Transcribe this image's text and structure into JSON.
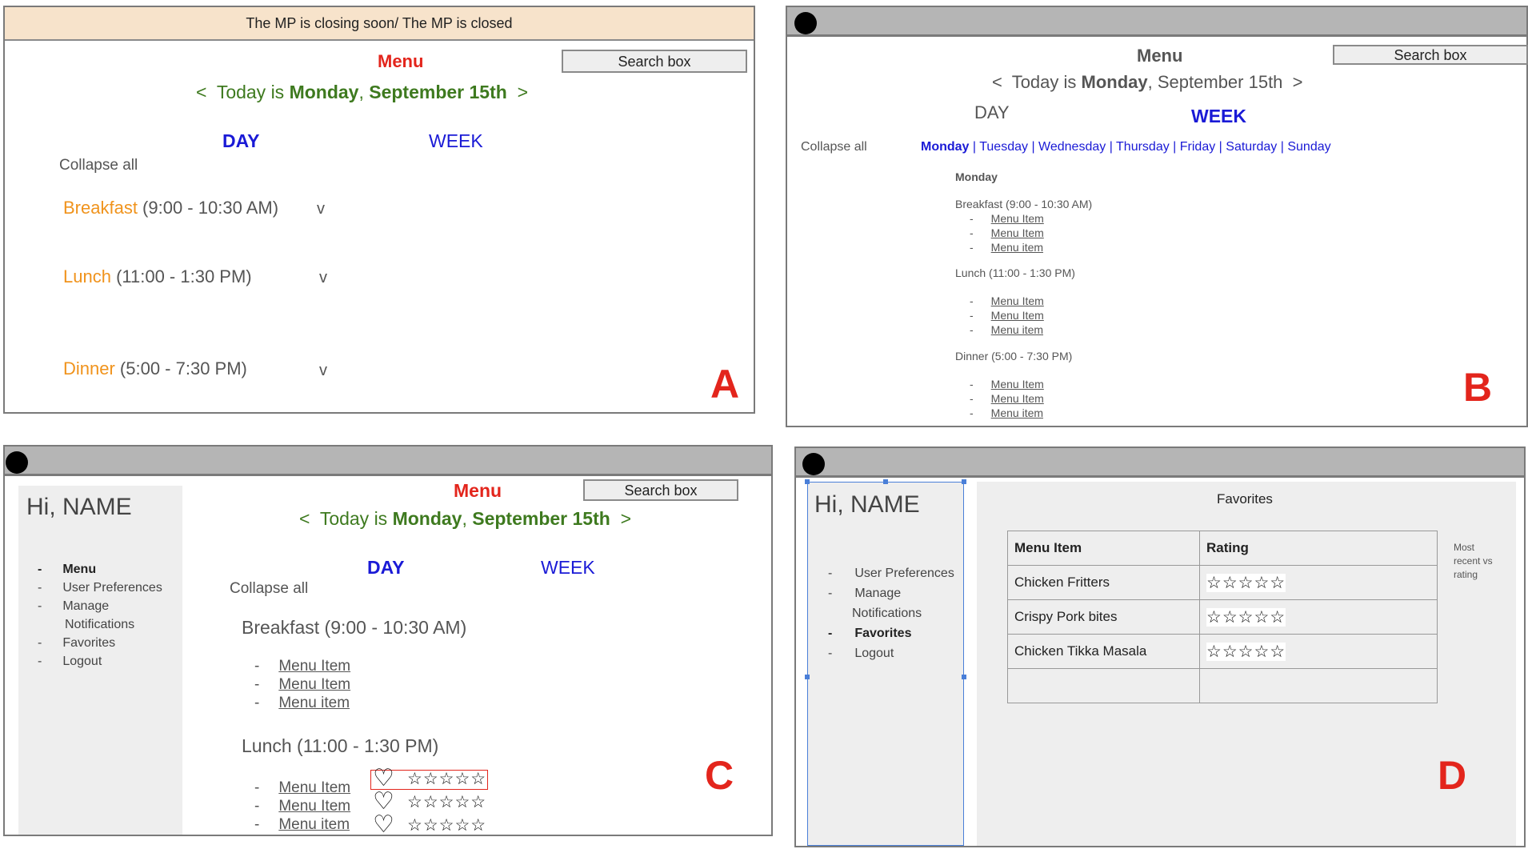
{
  "panel_a": {
    "banner": "The MP is closing soon/ The MP is closed",
    "menu_title": "Menu",
    "search": "Search box",
    "date_prev": "<",
    "date_prefix": "Today is ",
    "date_day": "Monday",
    "date_sep": ", ",
    "date_date": "September 15th",
    "date_next": ">",
    "tab_day": "DAY",
    "tab_week": "WEEK",
    "collapse": "Collapse all",
    "meals": [
      {
        "name": "Breakfast",
        "time": " (9:00 - 10:30 AM)",
        "toggle": "v"
      },
      {
        "name": "Lunch",
        "time": " (11:00 - 1:30 PM)",
        "toggle": "v"
      },
      {
        "name": "Dinner",
        "time": " (5:00 - 7:30 PM)",
        "toggle": "v"
      }
    ],
    "letter": "A"
  },
  "panel_b": {
    "menu_title": "Menu",
    "search": "Search box",
    "date_prev": "<",
    "date_prefix": "Today is ",
    "date_day": "Monday",
    "date_sep": ", ",
    "date_date": "September 15th",
    "date_next": ">",
    "tab_day": "DAY",
    "tab_week": "WEEK",
    "collapse": "Collapse all",
    "days": [
      "Monday",
      "Tuesday",
      "Wednesday",
      "Thursday",
      "Friday",
      "Saturday",
      "Sunday"
    ],
    "day_sep": " | ",
    "day_heading": "Monday",
    "meals": [
      {
        "header": "Breakfast  (9:00 - 10:30 AM)",
        "items": [
          "Menu Item",
          "Menu Item",
          "Menu item"
        ]
      },
      {
        "header": "Lunch (11:00 - 1:30 PM)",
        "items": [
          "Menu Item",
          "Menu Item",
          "Menu item"
        ]
      },
      {
        "header": "Dinner (5:00 - 7:30 PM)",
        "items": [
          "Menu Item",
          "Menu Item",
          "Menu item"
        ]
      }
    ],
    "bullet": "-",
    "letter": "B"
  },
  "panel_c": {
    "greeting": "Hi, NAME",
    "nav": [
      "Menu",
      "User Preferences",
      "Manage",
      "Notifications",
      "Favorites",
      "Logout"
    ],
    "bullet": "-",
    "menu_title": "Menu",
    "search": "Search box",
    "date_prev": "<",
    "date_prefix": "Today is ",
    "date_day": "Monday",
    "date_sep": ", ",
    "date_date": "September 15th",
    "date_next": ">",
    "tab_day": "DAY",
    "tab_week": "WEEK",
    "collapse": "Collapse all",
    "breakfast_header": "Breakfast  (9:00 - 10:30 AM)",
    "breakfast_items": [
      "Menu Item",
      "Menu Item",
      "Menu item"
    ],
    "lunch_header": "Lunch (11:00 - 1:30 PM)",
    "lunch_items": [
      "Menu Item",
      "Menu Item",
      "Menu item"
    ],
    "heart": "♡",
    "stars": "☆☆☆☆☆",
    "letter": "C"
  },
  "panel_d": {
    "greeting": "Hi, NAME",
    "nav": [
      "User Preferences",
      "Manage",
      "Notifications",
      "Favorites",
      "Logout"
    ],
    "bullet": "-",
    "favorites_title": "Favorites",
    "table_headers": [
      "Menu Item",
      "Rating"
    ],
    "rows": [
      {
        "item": "Chicken Fritters",
        "rating": "☆☆☆☆☆"
      },
      {
        "item": "Crispy Pork bites",
        "rating": "☆☆☆☆☆"
      },
      {
        "item": "Chicken Tikka Masala",
        "rating": "☆☆☆☆☆"
      },
      {
        "item": "",
        "rating": ""
      }
    ],
    "sort_note_1": "Most",
    "sort_note_2": "recent vs",
    "sort_note_3": "rating",
    "letter": "D"
  }
}
